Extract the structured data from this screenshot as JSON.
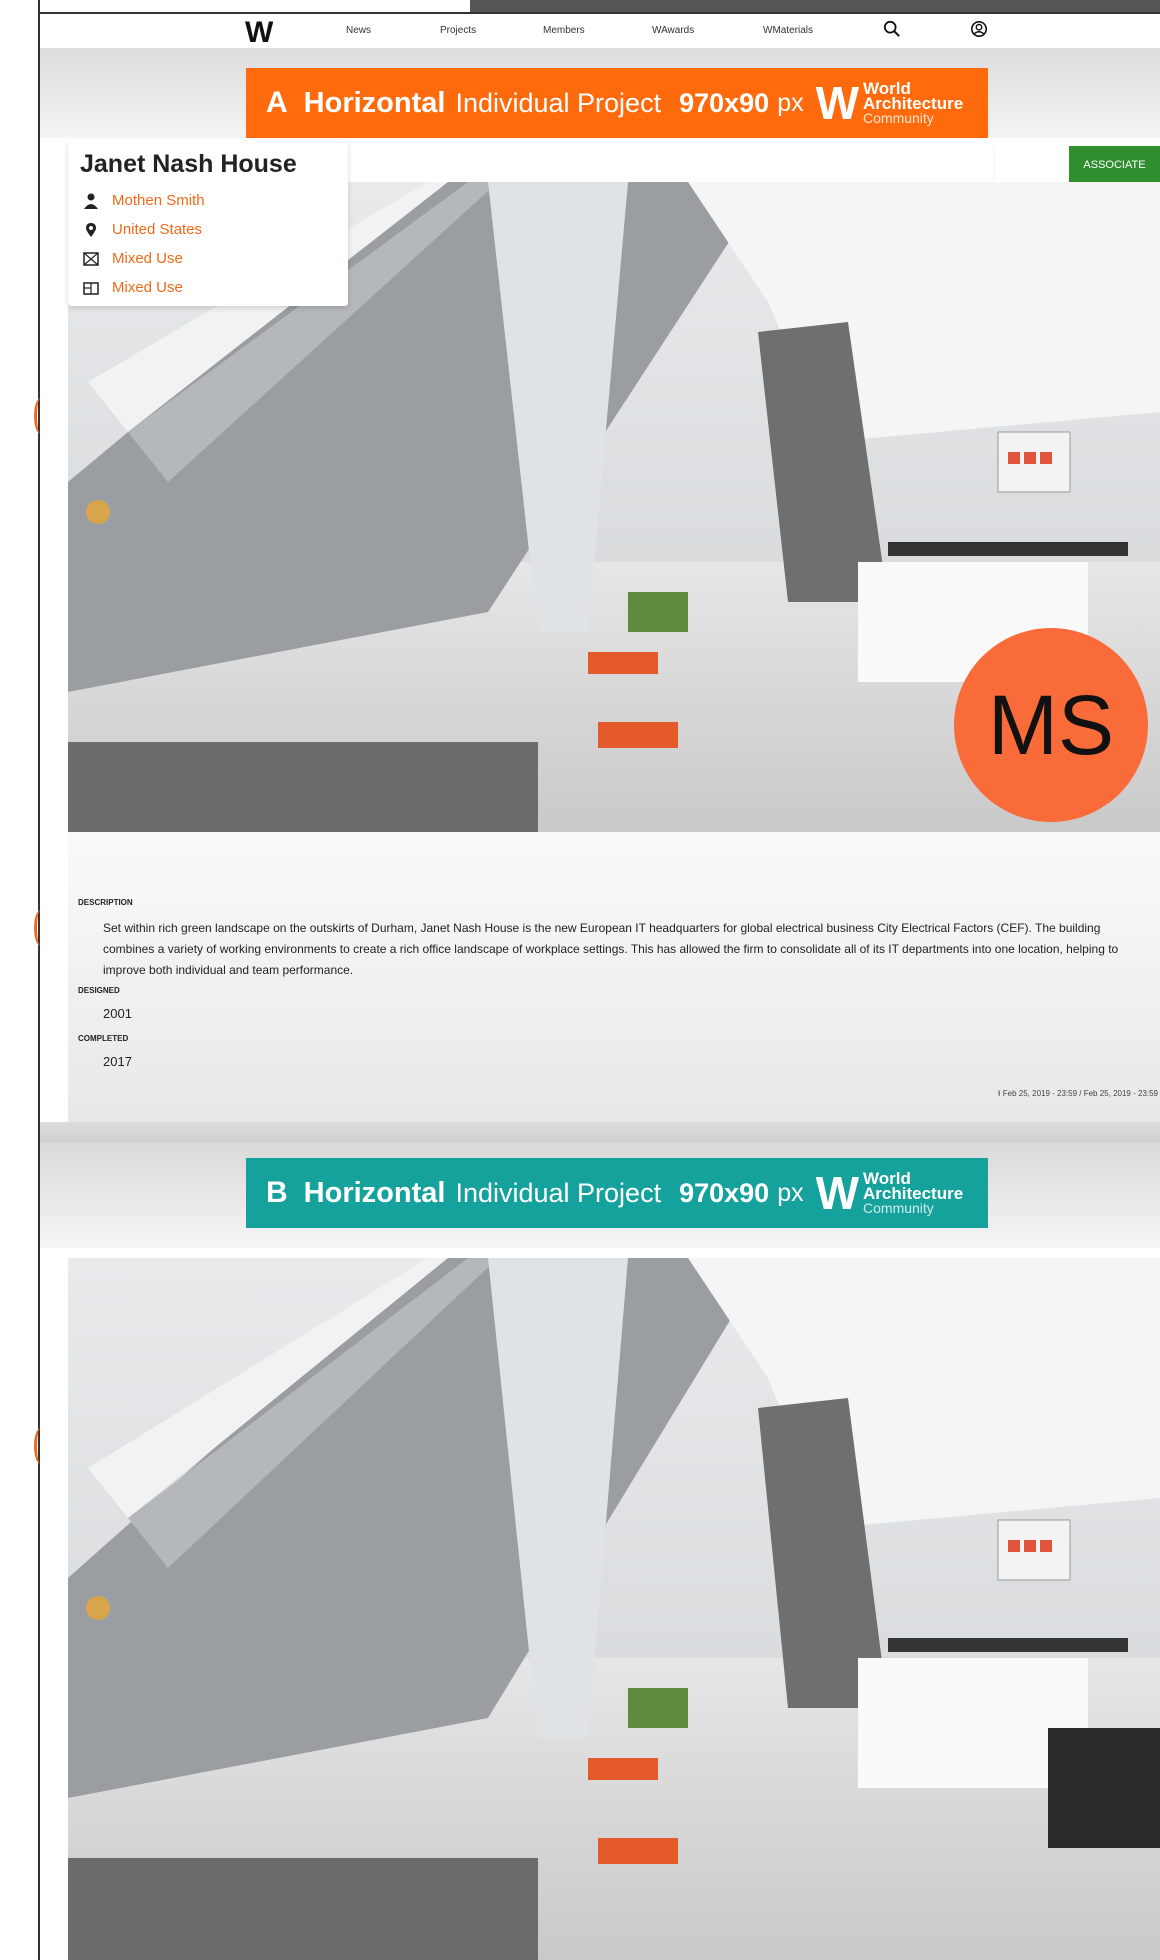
{
  "nav": {
    "logo": "W",
    "items": [
      "News",
      "Projects",
      "Members",
      "WAwards",
      "WMaterials"
    ]
  },
  "banner_a": {
    "letter": "A",
    "word1": "Horizontal",
    "word2": "Individual Project",
    "size": "970x90",
    "unit": "px",
    "logo": "W",
    "brand_line1": "World",
    "brand_line2": "Architecture",
    "brand_line3": "Community",
    "color": "#ff6a0c"
  },
  "banner_b": {
    "letter": "B",
    "word1": "Horizontal",
    "word2": "Individual Project",
    "size": "970x90",
    "unit": "px",
    "logo": "W",
    "brand_line1": "World",
    "brand_line2": "Architecture",
    "brand_line3": "Community",
    "color": "#15a29c"
  },
  "project": {
    "title": "Janet Nash House",
    "author": "Mothen Smith",
    "location": "United States",
    "type1": "Mixed Use",
    "type2": "Mixed Use",
    "badge": "ASSOCIATE",
    "avatar_initials": "MS"
  },
  "details": {
    "description_label": "DESCRIPTION",
    "description": "Set within rich green landscape on the outskirts of Durham, Janet Nash House is the new European IT headquarters for global electrical business City Electrical Factors (CEF). The building combines a variety of working environments to create a rich office landscape of workplace settings. This has allowed the firm to consolidate all of its IT departments into one location, helping to improve both individual and team performance.",
    "designed_label": "DESIGNED",
    "designed": "2001",
    "completed_label": "COMPLETED",
    "completed": "2017",
    "timestamp": "Feb 25, 2019 - 23:59 / Feb 25, 2019 - 23:59"
  },
  "colors": {
    "accent": "#f06a1a",
    "associate": "#2f8f2f"
  }
}
